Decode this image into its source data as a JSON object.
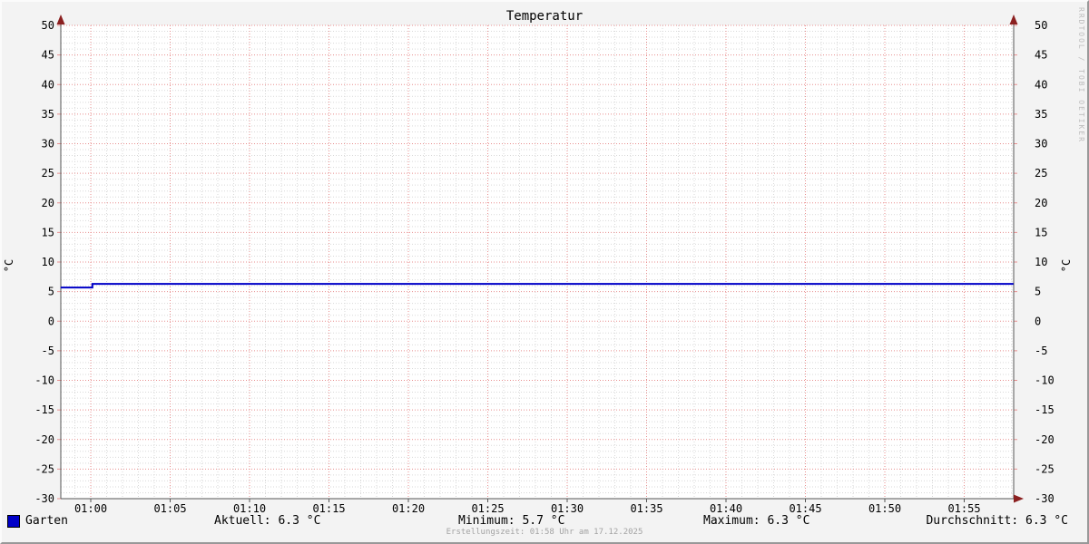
{
  "title": "Temperatur",
  "watermark": "RRDTOOL / TOBI OETIKER",
  "footer": {
    "created": "Erstellungszeit: 01:58 Uhr am 17.12.2025"
  },
  "legend": {
    "series_label": "Garten",
    "series_color": "#0000c8",
    "stats": {
      "current": "Aktuell: 6.3 °C",
      "minimum": "Minimum: 5.7 °C",
      "maximum": "Maximum: 6.3 °C",
      "average": "Durchschnitt: 6.3 °C"
    }
  },
  "chart_data": {
    "type": "line",
    "title": "Temperatur",
    "ylabel": "°C",
    "ylabel_right": "°C",
    "ylim": [
      -30,
      50
    ],
    "y_major_step": 5,
    "y_minor_step": 1,
    "y_tick_labels": [
      "50",
      "45",
      "40",
      "35",
      "30",
      "25",
      "20",
      "15",
      "10",
      "5",
      "0",
      "-5",
      "-10",
      "-15",
      "-20",
      "-25",
      "-30"
    ],
    "x_tick_labels": [
      "01:00",
      "01:05",
      "01:10",
      "01:15",
      "01:20",
      "01:25",
      "01:30",
      "01:35",
      "01:40",
      "01:45",
      "01:50",
      "01:55"
    ],
    "x_window_minutes_rel_0100": [
      -1.9,
      58.1
    ],
    "x_minor_step_minutes": 1,
    "grid": true,
    "legend_position": "bottom",
    "series": [
      {
        "name": "Garten",
        "color": "#0000c8",
        "unit": "°C",
        "points_minutes_rel_0100": [
          [
            -1.9,
            5.7
          ],
          [
            0.1,
            5.7
          ],
          [
            0.1,
            6.3
          ],
          [
            58.1,
            6.3
          ]
        ],
        "stats": {
          "current": 6.3,
          "min": 5.7,
          "max": 6.3,
          "avg": 6.3
        }
      }
    ]
  },
  "colors": {
    "background": "#f3f3f3",
    "plot_background": "#ffffff",
    "grid_major": "#e88f8f",
    "grid_minor": "#d9d9d9",
    "axis": "#555555",
    "arrow": "#8b2020",
    "line": "#0000c8",
    "text": "#000000",
    "muted_text": "#a3a3a3",
    "watermark_text": "#bdbdbd"
  }
}
